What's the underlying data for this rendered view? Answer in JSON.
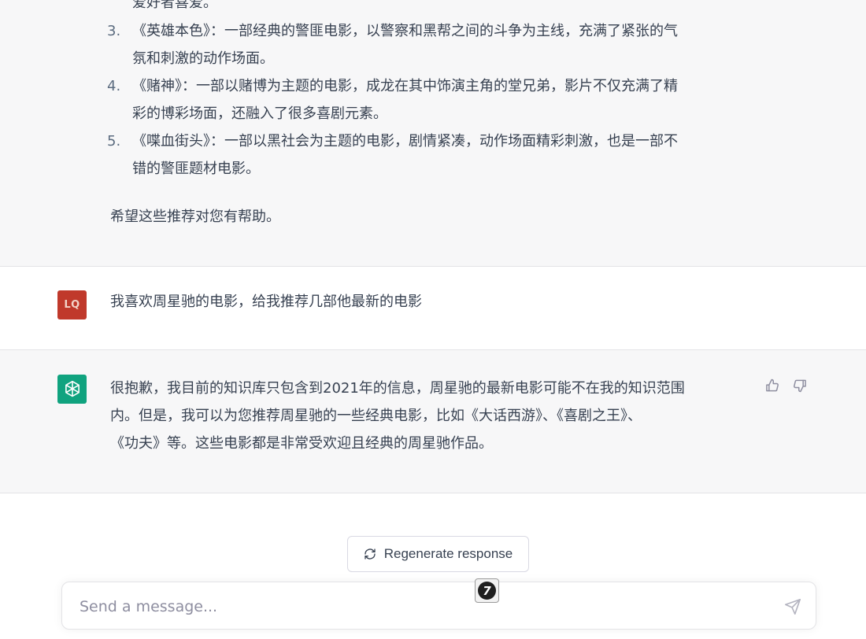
{
  "previous_response": {
    "partial_line": "爱好者喜爱。",
    "items": [
      {
        "num": "3.",
        "line1": "《英雄本色》：一部经典的警匪电影，以警察和黑帮之间的斗争为主线，充满了紧张的气",
        "line2": "氛和刺激的动作场面。"
      },
      {
        "num": "4.",
        "line1": "《赌神》：一部以赌博为主题的电影，成龙在其中饰演主角的堂兄弟，影片不仅充满了精",
        "line2": "彩的博彩场面，还融入了很多喜剧元素。"
      },
      {
        "num": "5.",
        "line1": "《喋血街头》：一部以黑社会为主题的电影，剧情紧凑，动作场面精彩刺激，也是一部不",
        "line2": "错的警匪题材电影。"
      }
    ],
    "closing": "希望这些推荐对您有帮助。"
  },
  "user_message": {
    "avatar_initials": "LQ",
    "text": "我喜欢周星驰的电影，给我推荐几部他最新的电影"
  },
  "assistant_message": {
    "line1": "很抱歉，我目前的知识库只包含到2021年的信息，周星驰的最新电影可能不在我的知识范围",
    "line2": "内。但是，我可以为您推荐周星驰的一些经典电影，比如《大话西游》、《喜剧之王》、",
    "line3": "《功夫》等。这些电影都是非常受欢迎且经典的周星驰作品。"
  },
  "regenerate_label": "Regenerate response",
  "composer": {
    "placeholder": "Send a message..."
  },
  "floating_badge_label": "7",
  "colors": {
    "assistant_bg": "#f7f7f8",
    "bot_avatar": "#10a37f",
    "user_avatar": "#c0392b"
  },
  "icons": [
    "openai-logo-icon",
    "thumbs-up-icon",
    "thumbs-down-icon",
    "refresh-icon",
    "send-icon"
  ]
}
